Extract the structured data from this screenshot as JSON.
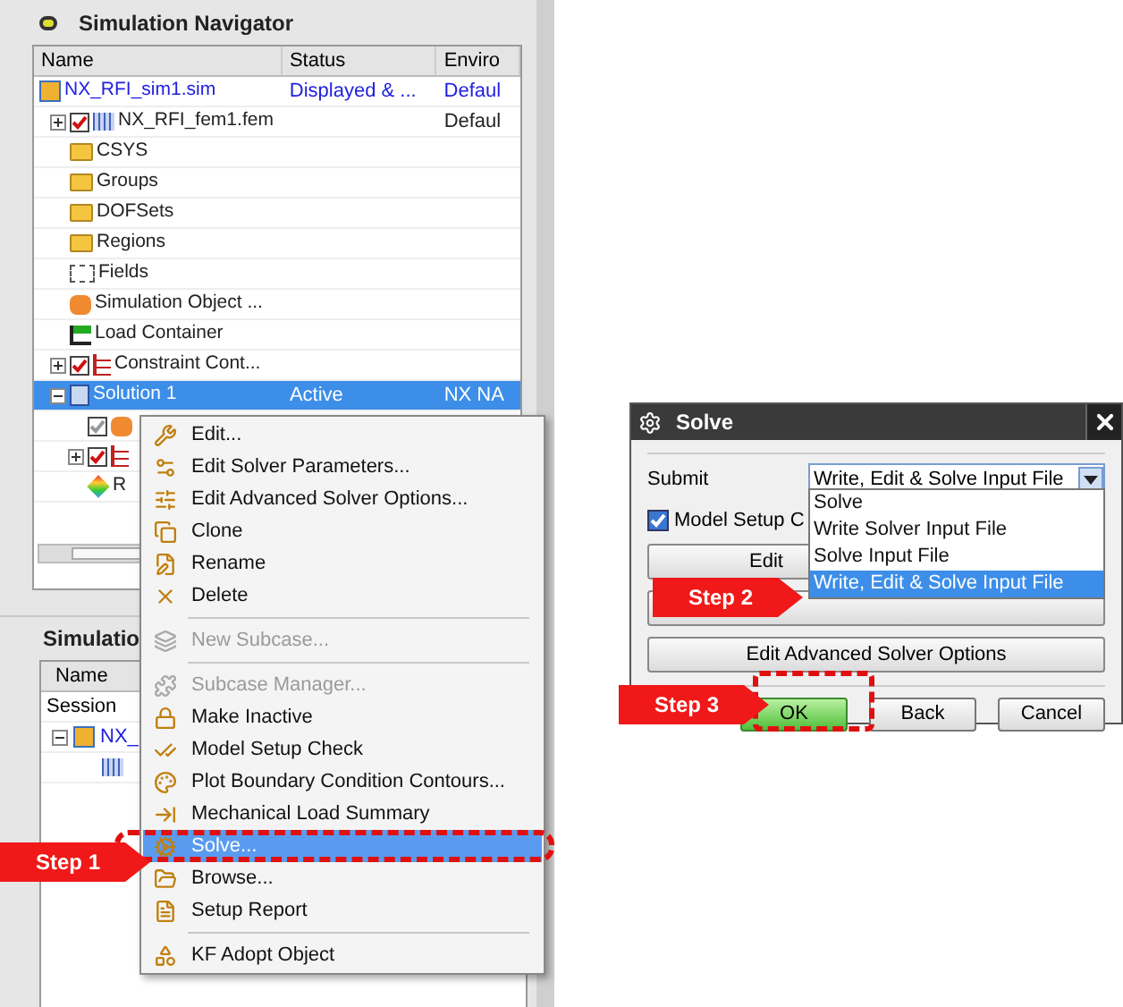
{
  "navigator": {
    "title": "Simulation Navigator",
    "columns": [
      "Name",
      "Status",
      "Enviro"
    ],
    "rows": [
      {
        "kind": "sim",
        "name": "NX_RFI_sim1.sim",
        "status": "Displayed & ...",
        "environment": "Defaul",
        "selected": false,
        "children": [
          {
            "kind": "fem",
            "name": "NX_RFI_fem1.fem",
            "environment": "Defaul",
            "checked": true,
            "expanded": false,
            "selected": false
          },
          {
            "kind": "folder",
            "name": "CSYS",
            "selected": false
          },
          {
            "kind": "folder",
            "name": "Groups",
            "selected": false
          },
          {
            "kind": "folder",
            "name": "DOFSets",
            "selected": false
          },
          {
            "kind": "folder",
            "name": "Regions",
            "selected": false
          },
          {
            "kind": "fields",
            "name": "Fields",
            "selected": false
          },
          {
            "kind": "object",
            "name": "Simulation Object ...",
            "selected": false
          },
          {
            "kind": "load",
            "name": "Load Container",
            "selected": false
          },
          {
            "kind": "constraint",
            "name": "Constraint Cont...",
            "checked": true,
            "expanded": false,
            "selected": false
          },
          {
            "kind": "solution",
            "name": "Solution 1",
            "status": "Active",
            "environment": "NX NA",
            "expanded": true,
            "selected": true,
            "children": [
              {
                "kind": "object",
                "checked": true,
                "selected": false
              },
              {
                "kind": "constraint",
                "checked": true,
                "expanded": false,
                "selected": false
              },
              {
                "kind": "result",
                "name": "R",
                "selected": false
              }
            ]
          }
        ]
      }
    ]
  },
  "lower_panel": {
    "title": "Simulatio",
    "column": "Name",
    "rows": [
      {
        "kind": "session",
        "name": "Session"
      },
      {
        "kind": "sim",
        "name": "NX_",
        "expanded": true
      },
      {
        "kind": "fem"
      }
    ]
  },
  "context_menu": [
    {
      "kind": "item",
      "label": "Edit...",
      "disabled": false,
      "selected": false
    },
    {
      "kind": "item",
      "label": "Edit Solver Parameters...",
      "disabled": false,
      "selected": false
    },
    {
      "kind": "item",
      "label": "Edit Advanced Solver Options...",
      "disabled": false,
      "selected": false
    },
    {
      "kind": "item",
      "label": "Clone",
      "disabled": false,
      "selected": false
    },
    {
      "kind": "item",
      "label": "Rename",
      "disabled": false,
      "selected": false
    },
    {
      "kind": "item",
      "label": "Delete",
      "disabled": false,
      "selected": false
    },
    {
      "kind": "separator"
    },
    {
      "kind": "item",
      "label": "New Subcase...",
      "disabled": true,
      "selected": false
    },
    {
      "kind": "separator"
    },
    {
      "kind": "item",
      "label": "Subcase Manager...",
      "disabled": true,
      "selected": false
    },
    {
      "kind": "item",
      "label": "Make Inactive",
      "disabled": false,
      "selected": false
    },
    {
      "kind": "item",
      "label": "Model Setup Check",
      "disabled": false,
      "selected": false
    },
    {
      "kind": "item",
      "label": "Plot Boundary Condition Contours...",
      "disabled": false,
      "selected": false
    },
    {
      "kind": "item",
      "label": "Mechanical Load Summary",
      "disabled": false,
      "selected": false
    },
    {
      "kind": "item",
      "label": "Solve...",
      "disabled": false,
      "selected": true
    },
    {
      "kind": "item",
      "label": "Browse...",
      "disabled": false,
      "selected": false
    },
    {
      "kind": "item",
      "label": "Setup Report",
      "disabled": false,
      "selected": false
    },
    {
      "kind": "separator"
    },
    {
      "kind": "item",
      "label": "KF Adopt Object",
      "disabled": false,
      "selected": false
    }
  ],
  "dialog": {
    "title": "Solve",
    "submit_label": "Submit",
    "submit_value": "Write, Edit & Solve Input File",
    "options": [
      {
        "label": "Solve",
        "selected": false
      },
      {
        "label": "Write Solver Input File",
        "selected": false
      },
      {
        "label": "Solve Input File",
        "selected": false
      },
      {
        "label": "Write, Edit & Solve Input File",
        "selected": true
      }
    ],
    "checkbox": {
      "label": "Model Setup C",
      "checked": true
    },
    "edit_button": "Edit",
    "advanced_button": "Edit Advanced Solver Options",
    "buttons": [
      {
        "kind": "ok",
        "label": "OK"
      },
      {
        "kind": "normal",
        "label": "Back"
      },
      {
        "kind": "normal",
        "label": "Cancel"
      }
    ]
  },
  "steps": [
    "Step 1",
    "Step 2",
    "Step 3"
  ]
}
